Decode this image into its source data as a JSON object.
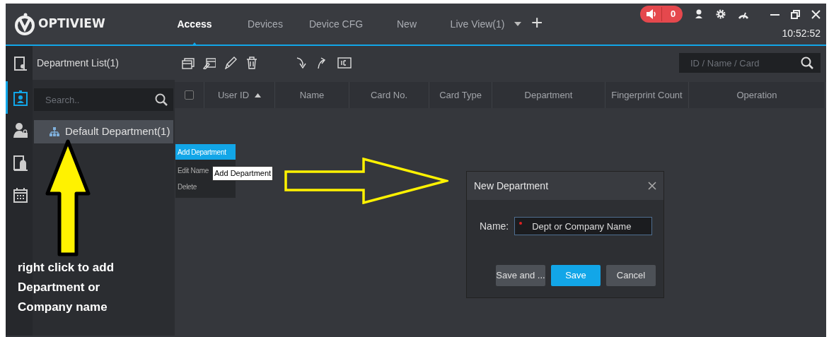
{
  "header": {
    "logo": "OPTIVIEW",
    "tabs": [
      {
        "label": "Access",
        "selected": true
      },
      {
        "label": "Devices",
        "selected": false
      },
      {
        "label": "Device CFG",
        "selected": false
      },
      {
        "label": "New",
        "selected": false
      },
      {
        "label": "Live View(1)",
        "selected": false
      }
    ],
    "add_tab": "+",
    "alarm_count": "0",
    "time": "10:52:52"
  },
  "sidebar": {
    "items": [
      {
        "kind": "door",
        "selected": false
      },
      {
        "kind": "badge",
        "selected": true
      },
      {
        "kind": "lock",
        "selected": false
      },
      {
        "kind": "device",
        "selected": false
      },
      {
        "kind": "calendar",
        "selected": false
      }
    ]
  },
  "department_panel": {
    "title": "Department List(1)",
    "search": {
      "placeholder": "Search.."
    },
    "tree": [
      {
        "label": "Default Department(1)",
        "selected": true
      }
    ]
  },
  "toolbar": {
    "search": {
      "placeholder": "ID / Name / Card"
    }
  },
  "table": {
    "select_all_checked": false,
    "columns": [
      {
        "label": "User ID",
        "sorted": true
      },
      {
        "label": "Name",
        "sorted": false
      },
      {
        "label": "Card No.",
        "sorted": false
      },
      {
        "label": "Card Type",
        "sorted": false
      },
      {
        "label": "Department",
        "sorted": false
      },
      {
        "label": "Fingerprint Count",
        "sorted": false
      },
      {
        "label": "Operation",
        "sorted": false
      }
    ]
  },
  "context_menu": {
    "items": [
      {
        "label": "Add Department",
        "selected": true
      },
      {
        "label": "Edit Name",
        "selected": false
      },
      {
        "label": "Delete",
        "selected": false
      }
    ]
  },
  "tooltip": "Add Department",
  "dialog": {
    "title": "New Department",
    "field": {
      "label": "Name:",
      "value": "Dept or Company Name",
      "required": true
    },
    "buttons": [
      {
        "label": "Save and ...",
        "primary": false
      },
      {
        "label": "Save",
        "primary": true
      },
      {
        "label": "Cancel",
        "primary": false
      }
    ]
  },
  "annotation": "right click to add Department or Company name"
}
